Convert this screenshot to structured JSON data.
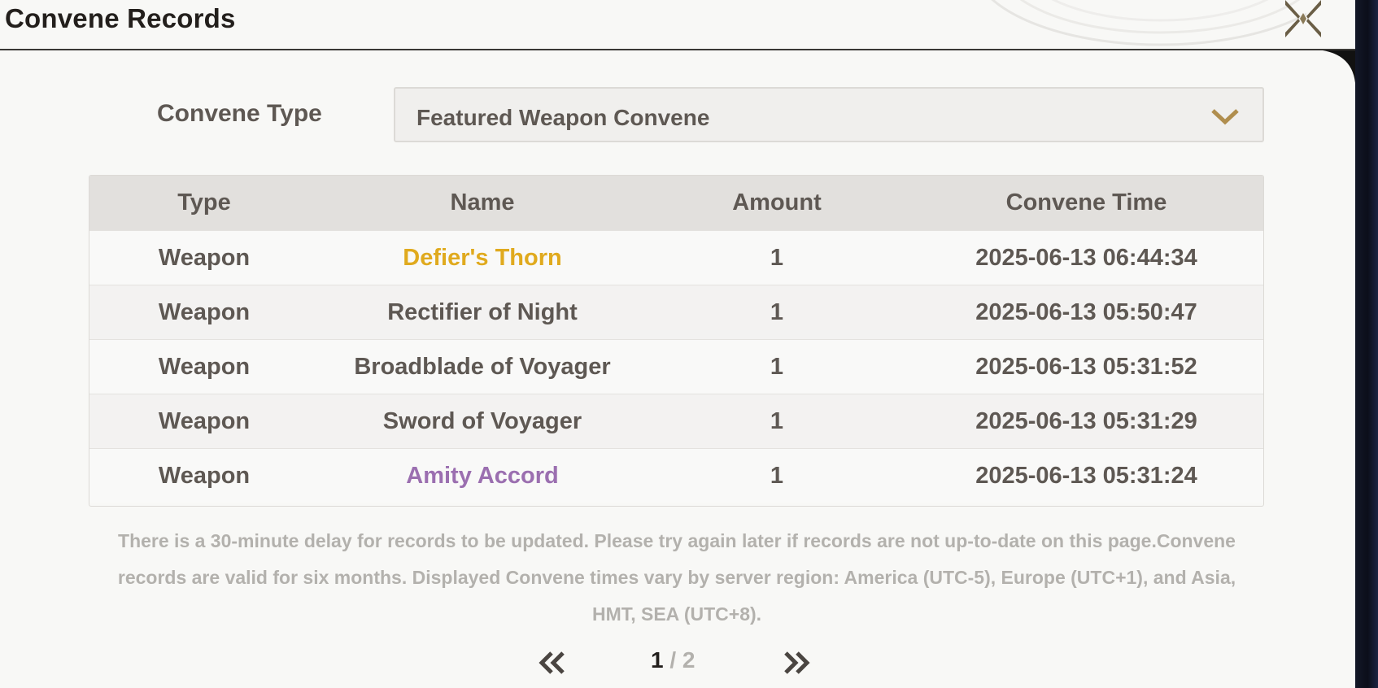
{
  "window": {
    "title": "Convene Records"
  },
  "filter": {
    "label": "Convene Type",
    "selected": "Featured Weapon Convene"
  },
  "table": {
    "headers": [
      "Type",
      "Name",
      "Amount",
      "Convene Time"
    ],
    "rows": [
      {
        "type": "Weapon",
        "name": "Defier's Thorn",
        "amount": "1",
        "time": "2025-06-13 06:44:34",
        "rarity_color": "#e0aa1e"
      },
      {
        "type": "Weapon",
        "name": "Rectifier of Night",
        "amount": "1",
        "time": "2025-06-13 05:50:47",
        "rarity_color": "#5e5853"
      },
      {
        "type": "Weapon",
        "name": "Broadblade of Voyager",
        "amount": "1",
        "time": "2025-06-13 05:31:52",
        "rarity_color": "#5e5853"
      },
      {
        "type": "Weapon",
        "name": "Sword of Voyager",
        "amount": "1",
        "time": "2025-06-13 05:31:29",
        "rarity_color": "#5e5853"
      },
      {
        "type": "Weapon",
        "name": "Amity Accord",
        "amount": "1",
        "time": "2025-06-13 05:31:24",
        "rarity_color": "#9b6fb0"
      }
    ]
  },
  "notice": "There is a 30-minute delay for records to be updated. Please try again later if records are not up-to-date on this page.Convene records are valid for six months. Displayed Convene times vary by server region: America (UTC-5), Europe (UTC+1), and Asia, HMT, SEA (UTC+8).",
  "pagination": {
    "current": "1",
    "separator": " / ",
    "total": "2"
  },
  "icons": {
    "close": "close-x-icon",
    "dropdown": "chevron-down-icon",
    "prev": "double-chevron-left-icon",
    "next": "double-chevron-right-icon"
  },
  "colors": {
    "gold": "#e0aa1e",
    "purple": "#9b6fb0",
    "accent": "#b08e4e",
    "text": "#5e5853"
  }
}
